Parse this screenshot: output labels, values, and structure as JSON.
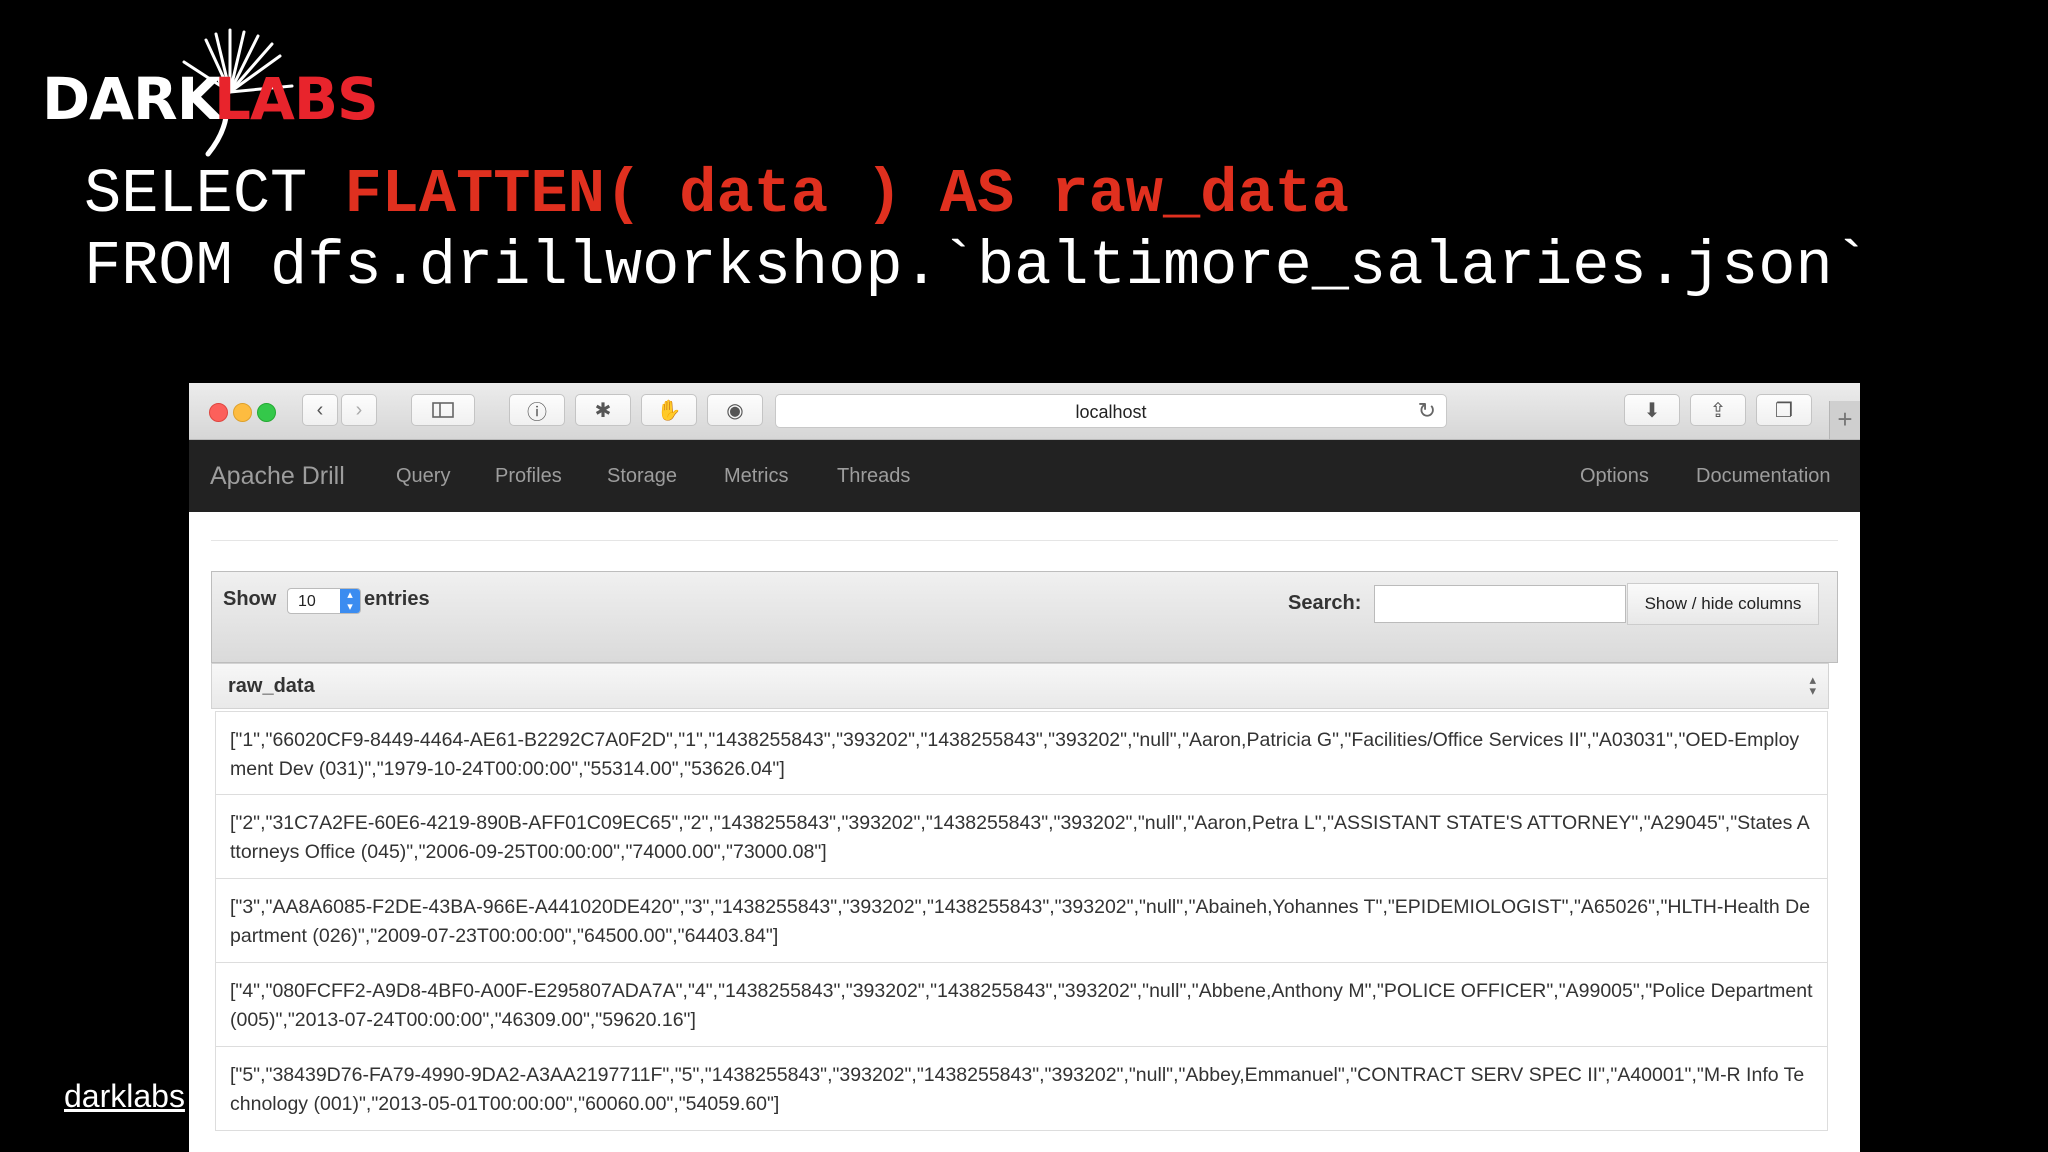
{
  "slide": {
    "logo": {
      "dark": "DARK",
      "labs": "LABS"
    },
    "sql": {
      "select_kw": "SELECT ",
      "select_expr": "FLATTEN( data ) AS raw_data",
      "from_line": "FROM dfs.drillworkshop.`baltimore_salaries.json`"
    },
    "footer_link": "darklabs"
  },
  "browser": {
    "url": "localhost"
  },
  "drill": {
    "brand": "Apache Drill",
    "nav_left": [
      "Query",
      "Profiles",
      "Storage",
      "Metrics",
      "Threads"
    ],
    "nav_right": [
      "Options",
      "Documentation"
    ],
    "table": {
      "show_label": "Show",
      "page_length": "10",
      "entries_label": "entries",
      "search_label": "Search:",
      "search_value": "",
      "colvis_label": "Show / hide columns",
      "column_header": "raw_data",
      "rows": [
        "[\"1\",\"66020CF9-8449-4464-AE61-B2292C7A0F2D\",\"1\",\"1438255843\",\"393202\",\"1438255843\",\"393202\",\"null\",\"Aaron,Patricia G\",\"Facilities/Office Services II\",\"A03031\",\"OED-Employment Dev (031)\",\"1979-10-24T00:00:00\",\"55314.00\",\"53626.04\"]",
        "[\"2\",\"31C7A2FE-60E6-4219-890B-AFF01C09EC65\",\"2\",\"1438255843\",\"393202\",\"1438255843\",\"393202\",\"null\",\"Aaron,Petra L\",\"ASSISTANT STATE'S ATTORNEY\",\"A29045\",\"States Attorneys Office (045)\",\"2006-09-25T00:00:00\",\"74000.00\",\"73000.08\"]",
        "[\"3\",\"AA8A6085-F2DE-43BA-966E-A441020DE420\",\"3\",\"1438255843\",\"393202\",\"1438255843\",\"393202\",\"null\",\"Abaineh,Yohannes T\",\"EPIDEMIOLOGIST\",\"A65026\",\"HLTH-Health Department (026)\",\"2009-07-23T00:00:00\",\"64500.00\",\"64403.84\"]",
        "[\"4\",\"080FCFF2-A9D8-4BF0-A00F-E295807ADA7A\",\"4\",\"1438255843\",\"393202\",\"1438255843\",\"393202\",\"null\",\"Abbene,Anthony M\",\"POLICE OFFICER\",\"A99005\",\"Police Department (005)\",\"2013-07-24T00:00:00\",\"46309.00\",\"59620.16\"]",
        "[\"5\",\"38439D76-FA79-4990-9DA2-A3AA2197711F\",\"5\",\"1438255843\",\"393202\",\"1438255843\",\"393202\",\"null\",\"Abbey,Emmanuel\",\"CONTRACT SERV SPEC II\",\"A40001\",\"M-R Info Technology (001)\",\"2013-05-01T00:00:00\",\"60060.00\",\"54059.60\"]"
      ]
    }
  }
}
